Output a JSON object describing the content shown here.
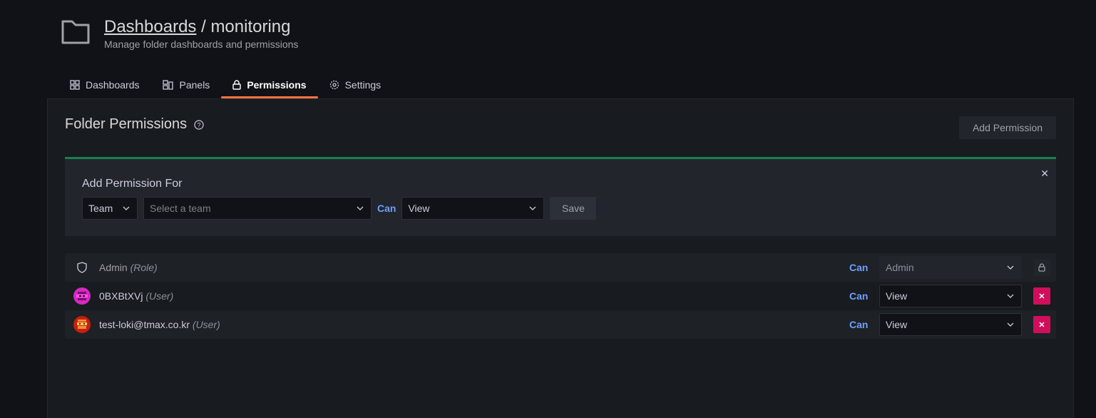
{
  "header": {
    "breadcrumb_link": "Dashboards",
    "separator": "/",
    "folder_name": "monitoring",
    "subtitle": "Manage folder dashboards and permissions"
  },
  "tabs": [
    {
      "label": "Dashboards",
      "icon": "apps-icon"
    },
    {
      "label": "Panels",
      "icon": "library-panel-icon"
    },
    {
      "label": "Permissions",
      "icon": "lock-icon",
      "active": true
    },
    {
      "label": "Settings",
      "icon": "cog-icon"
    }
  ],
  "panel": {
    "title": "Folder Permissions",
    "add_button": "Add Permission"
  },
  "add_form": {
    "label": "Add Permission For",
    "type_value": "Team",
    "target_placeholder": "Select a team",
    "can_label": "Can",
    "permission_value": "View",
    "save_label": "Save"
  },
  "permissions": [
    {
      "name": "Admin",
      "kind": "(Role)",
      "can": "Can",
      "level": "Admin",
      "locked": true
    },
    {
      "name": "0BXBtXVj",
      "kind": "(User)",
      "can": "Can",
      "level": "View",
      "locked": false
    },
    {
      "name": "test-loki@tmax.co.kr",
      "kind": "(User)",
      "can": "Can",
      "level": "View",
      "locked": false
    }
  ],
  "colors": {
    "accent_tab": "#ff7441",
    "can_text": "#6e9fff",
    "delete_button": "#d10e5c",
    "add_box_border": "#1a7f4b"
  }
}
